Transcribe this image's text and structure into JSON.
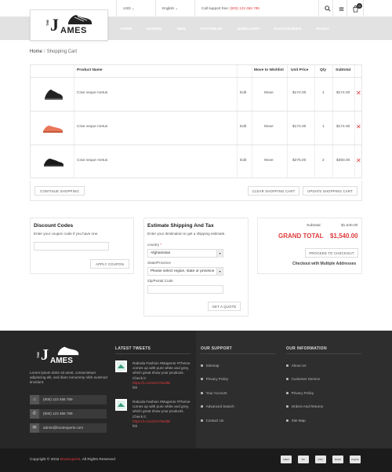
{
  "header": {
    "currency": "USD",
    "language": "English",
    "support_label": "Call support free:",
    "support_phone": "(800) 123 456 789",
    "cart_count": "0",
    "nav": [
      "HOME",
      "WOMEN",
      "MEN",
      "FOOTWEAR",
      "JEWELLERY",
      "ACCESSORIES",
      "PAGES"
    ]
  },
  "logo": {
    "the": "THE",
    "j": "J",
    "rest": "AMES"
  },
  "breadcrumb": {
    "home": "Home",
    "current": "Shopping Cart"
  },
  "cart": {
    "headers": {
      "product": "Product Name",
      "wishlist": "Move to Wishlist",
      "price": "Unit Price",
      "qty": "Qty",
      "subtotal": "Subtotal"
    },
    "rows": [
      {
        "name": "Cras neque metus",
        "edit": "Edit",
        "move": "Move",
        "price": "$174.00",
        "qty": "1",
        "subtotal": "$174.00",
        "color": "#222"
      },
      {
        "name": "Cras neque metus",
        "edit": "Edit",
        "move": "Move",
        "price": "$174.00",
        "qty": "1",
        "subtotal": "$174.00",
        "color": "#e8775a"
      },
      {
        "name": "Cras neque metus",
        "edit": "Edit",
        "move": "Move",
        "price": "$275.00",
        "qty": "2",
        "subtotal": "$350.00",
        "color": "#1a1a1a"
      }
    ],
    "continue": "CONTINUE SHOPPING",
    "clear": "CLEAR SHOPPING CART",
    "update": "UPDATE SHOPPING CART"
  },
  "discount": {
    "title": "Discount Codes",
    "desc": "Enter your coupon code if you have one.",
    "apply": "APPLY COUPON"
  },
  "shipping": {
    "title": "Estimate Shipping And Tax",
    "desc": "Enter your destination to get a shipping estimate.",
    "country_label": "country",
    "country_value": "Afghanistan",
    "state_label": "State/Province",
    "state_value": "Please select region, state or province",
    "zip_label": "Zip/Postal Code",
    "quote": "GET A QUOTE"
  },
  "totals": {
    "subtotal_label": "Subtotal",
    "subtotal_value": "$1,540.00",
    "grand_label": "GRAND TOTAL",
    "grand_value": "$1,540.00",
    "checkout": "PROCEED TO CHECKOUT",
    "multi": "Checkout with Multiple Addresses"
  },
  "footer": {
    "about": "Lorem ipsum dolor sit amet, consectetuer adipiscing elit, sed diam nonummy nibh euismod tincidunt.",
    "phone1": "(800) 123 456 789",
    "phone2": "(800) 123 456 789",
    "email": "admin@bootexperts.com",
    "tweets_title": "LATEST TWEETS",
    "tweet_text": "Raboda Fashion #Magento #Theme comes up with pure white and grey, which great show your products. Check it:",
    "tweet_link": "https://t.co/iuOOYBwltB",
    "tweet_user": "fsh",
    "support_title": "OUR SUPPORT",
    "support_links": [
      "Sitemap",
      "Privacy Policy",
      "Your Account",
      "Advanced Search",
      "Contact Us"
    ],
    "info_title": "OUR INFORMATION",
    "info_links": [
      "About Us",
      "Customer Service",
      "Privacy Policy",
      "Orders And Returns",
      "Site Map"
    ],
    "copyright": "Copyright © 2016",
    "copyright_brand": "Bootexperts",
    "copyright_rest": ". All Rights Reserved",
    "payments": [
      "AMEX",
      "MC",
      "DISC",
      "BANK",
      "PayPal"
    ]
  },
  "colors": {
    "accent": "#e03a3a"
  }
}
